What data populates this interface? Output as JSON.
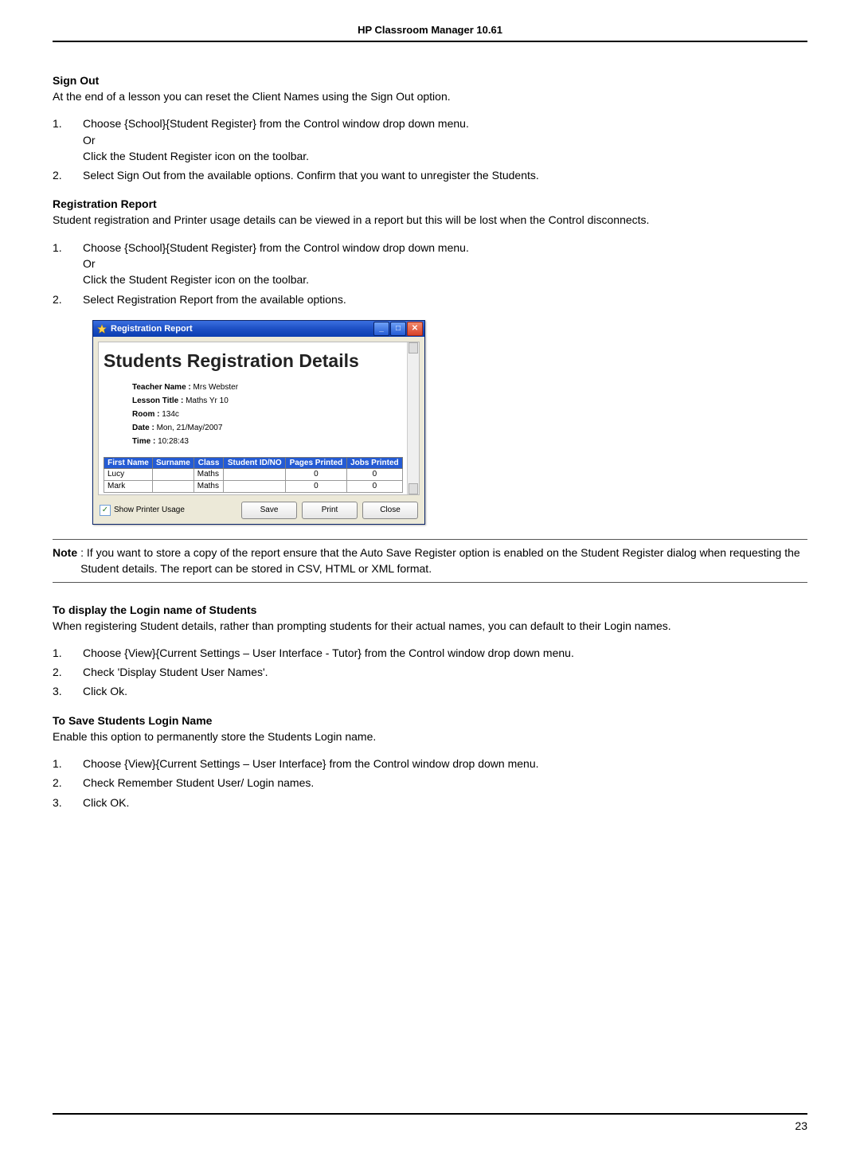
{
  "header": {
    "title": "HP Classroom Manager 10.61"
  },
  "signout": {
    "heading": "Sign Out",
    "intro": "At the end of a lesson you can reset the Client Names using the Sign Out option.",
    "steps": [
      "Choose {School}{Student Register} from the Control window drop down menu.\nOr\nClick the Student Register icon on the toolbar.",
      "Select Sign Out from the available options. Confirm that you want to unregister the Students."
    ]
  },
  "regreport": {
    "heading": "Registration Report",
    "intro": "Student registration and Printer usage details can be viewed in a report but this will be lost when the Control disconnects.",
    "steps": [
      "Choose {School}{Student Register} from the Control window drop down menu.\nOr\nClick the Student Register icon on the toolbar.",
      "Select Registration Report from the available options."
    ]
  },
  "window": {
    "title": "Registration Report",
    "report_heading": "Students Registration Details",
    "meta": {
      "teacher_label": "Teacher Name :",
      "teacher_value": "Mrs Webster",
      "lesson_label": "Lesson Title :",
      "lesson_value": "Maths Yr 10",
      "room_label": "Room :",
      "room_value": "134c",
      "date_label": "Date :",
      "date_value": "Mon, 21/May/2007",
      "time_label": "Time :",
      "time_value": "10:28:43"
    },
    "columns": [
      "First Name",
      "Surname",
      "Class",
      "Student ID/NO",
      "Pages Printed",
      "Jobs Printed"
    ],
    "rows": [
      {
        "first": "Lucy",
        "surname": "",
        "class": "Maths",
        "id": "",
        "pages": "0",
        "jobs": "0"
      },
      {
        "first": "Mark",
        "surname": "",
        "class": "Maths",
        "id": "",
        "pages": "0",
        "jobs": "0"
      }
    ],
    "show_printer_label": "Show Printer Usage",
    "buttons": {
      "save": "Save",
      "print": "Print",
      "close": "Close"
    }
  },
  "note": {
    "label": "Note",
    "text": ": If you want to store a copy of the report ensure that the Auto Save Register option is enabled on the Student Register dialog when requesting the Student details. The report can be stored in CSV, HTML or XML format."
  },
  "loginname": {
    "heading": "To display the Login name of Students",
    "intro": "When registering Student details, rather than prompting students for their actual names, you can default to their Login names.",
    "steps": [
      "Choose {View}{Current Settings – User Interface - Tutor} from the Control window drop down menu.",
      "Check 'Display Student User Names'.",
      "Click Ok."
    ]
  },
  "savelogin": {
    "heading": "To Save Students Login Name",
    "intro": "Enable this option to permanently store the Students Login name.",
    "steps": [
      "Choose {View}{Current Settings – User Interface} from the Control window drop down menu.",
      "Check Remember Student User/ Login names.",
      "Click OK."
    ]
  },
  "page_number": "23"
}
